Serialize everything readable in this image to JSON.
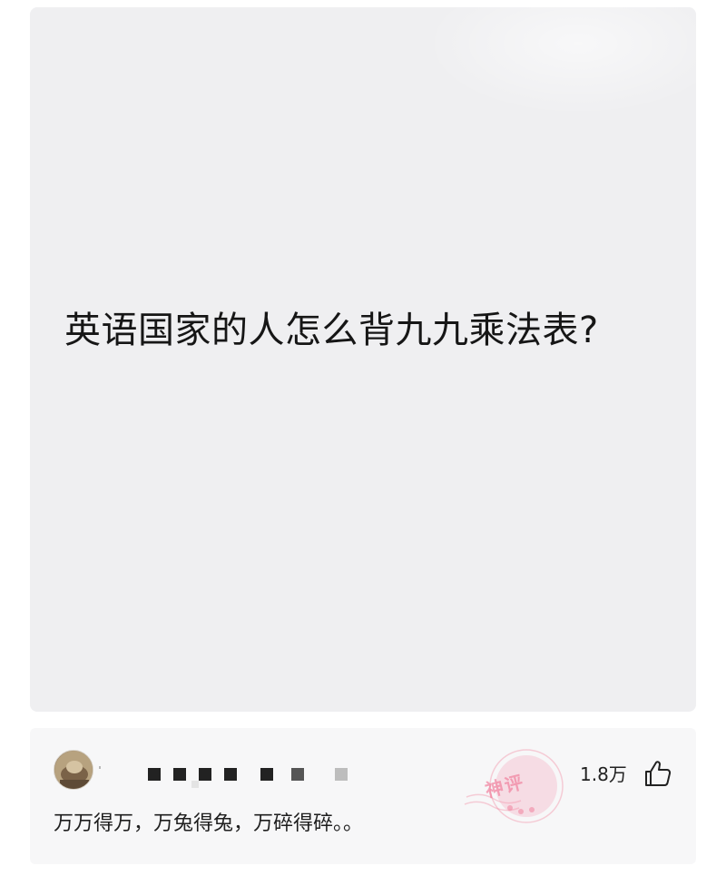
{
  "post": {
    "question": "英语国家的人怎么背九九乘法表?"
  },
  "comment": {
    "like_count": "1.8万",
    "text": "万万得万，万兔得兔，万碎得碎。。",
    "stamp_text": "神评"
  },
  "icons": {
    "like": "thumbs-up-icon",
    "avatar": "user-avatar-image"
  },
  "colors": {
    "post_background": "#efeff1",
    "comment_background": "#f7f7f8",
    "stamp": "#f078a0"
  }
}
